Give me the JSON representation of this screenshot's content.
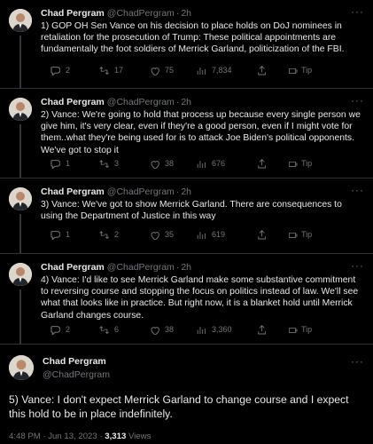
{
  "author": {
    "name": "Chad Pergram",
    "handle": "@ChadPergram",
    "sep": "·"
  },
  "tweets": [
    {
      "time": "2h",
      "text": "1) GOP OH Sen Vance on his decision to place holds on DoJ nominees in retaliation for the prosecution of Trump: These political appointments are fundamentally the foot soldiers of Merrick Garland, politicization of the FBI.",
      "replies": "2",
      "retweets": "17",
      "likes": "75",
      "views": "7,834",
      "tip": "Tip"
    },
    {
      "time": "2h",
      "text": "2) Vance: We're going to hold that process up because every single person we give him, it's very clear, even if they're a good person, even if I might vote for them..what they're being used for is to attack Joe Biden's political opponents. We've got to stop it",
      "replies": "1",
      "retweets": "3",
      "likes": "38",
      "views": "676",
      "tip": "Tip"
    },
    {
      "time": "2h",
      "text": "3) Vance: We've got to show Merrick Garland. There are consequences to using the Department of Justice in this way",
      "replies": "1",
      "retweets": "2",
      "likes": "35",
      "views": "619",
      "tip": "Tip"
    },
    {
      "time": "2h",
      "text": "4) Vance: I'd like to see Merrick Garland make some substantive commitment to reversing course and stopping the focus on politics instead of law. We'll see what that looks like in practice. But right now, it is a blanket hold until Merrick Garland changes course.",
      "replies": "2",
      "retweets": "6",
      "likes": "38",
      "views": "3,360",
      "tip": "Tip"
    }
  ],
  "focus": {
    "text": "5) Vance: I don't expect Merrick Garland to change course and I expect this hold to be in place indefinitely.",
    "timestamp": "4:48 PM · Jun 13, 2023 · ",
    "views_count": "3,313",
    "views_label": " Views"
  },
  "icons": [
    "reply-icon",
    "retweet-icon",
    "like-icon",
    "views-icon",
    "share-icon",
    "tip-icon",
    "more-icon"
  ],
  "colors": {
    "background": "#000000",
    "text": "#e7e9ea",
    "muted": "#71767b",
    "divider": "#2f3336"
  }
}
